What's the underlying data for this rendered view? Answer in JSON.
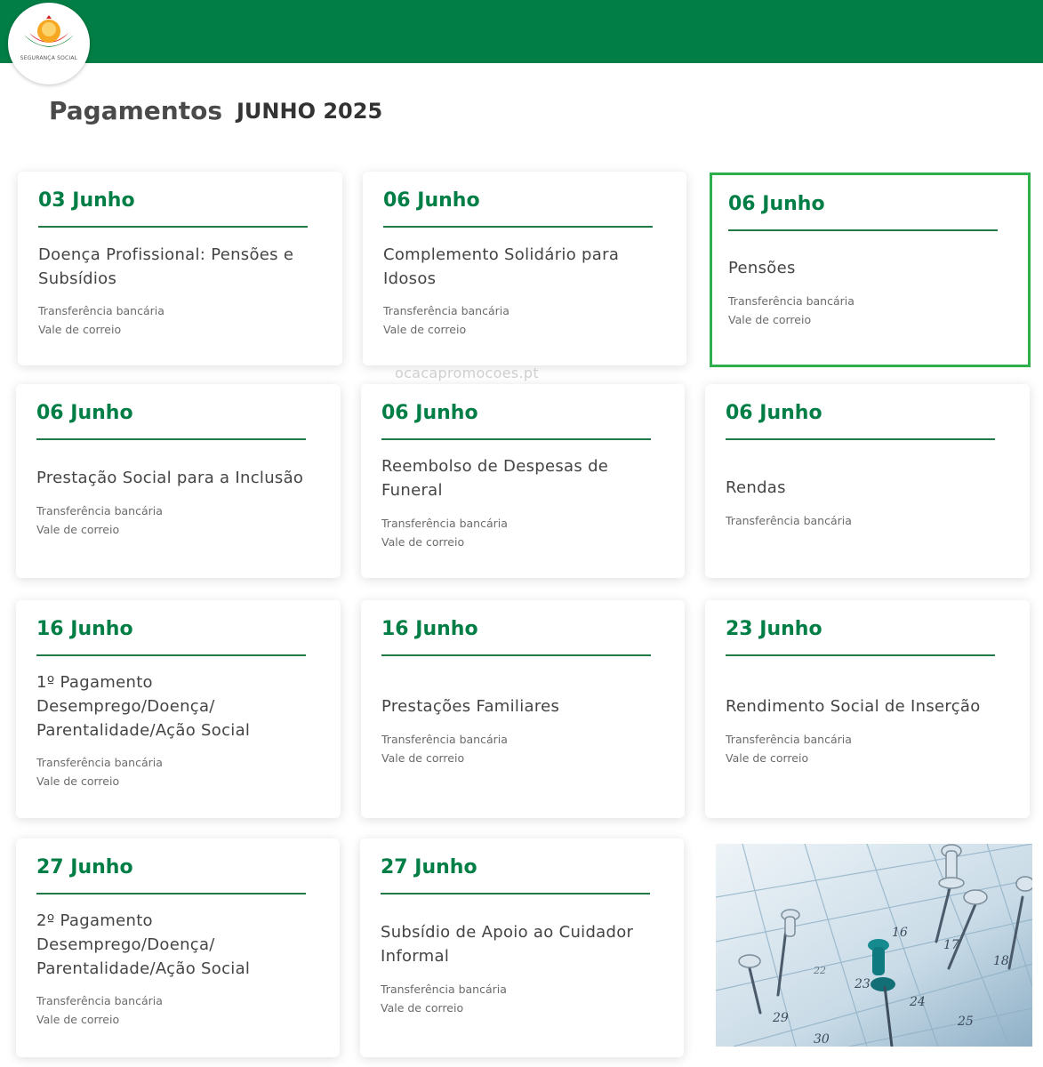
{
  "header": {
    "logo_text": "SEGURANÇA SOCIAL",
    "brand_color": "#007e45"
  },
  "page": {
    "title": "Pagamentos",
    "month": "JUNHO 2025"
  },
  "watermark": "ocacapromocoes.pt",
  "cards": [
    {
      "date": "03 Junho",
      "title_lines": [
        "Doença Profissional: Pensões e",
        "Subsídios"
      ],
      "methods": [
        "Transferência bancária",
        "Vale de correio"
      ]
    },
    {
      "date": "06 Junho",
      "title_lines": [
        "Complemento Solidário para",
        "Idosos"
      ],
      "methods": [
        "Transferência bancária",
        "Vale de correio"
      ]
    },
    {
      "date": "06 Junho",
      "title_lines": [
        "Pensões"
      ],
      "methods": [
        "Transferência bancária",
        "Vale de correio"
      ],
      "highlighted": true
    },
    {
      "date": "06 Junho",
      "title_lines": [
        "Prestação Social para a Inclusão"
      ],
      "methods": [
        "Transferência bancária",
        "Vale de correio"
      ]
    },
    {
      "date": "06 Junho",
      "title_lines": [
        "Reembolso de Despesas de",
        "Funeral"
      ],
      "methods": [
        "Transferência bancária",
        "Vale de correio"
      ]
    },
    {
      "date": "06 Junho",
      "title_lines": [
        "Rendas"
      ],
      "methods": [
        "Transferência bancária"
      ]
    },
    {
      "date": "16 Junho",
      "title_lines": [
        "1º Pagamento",
        "Desemprego/Doença/",
        "Parentalidade/Ação Social"
      ],
      "methods": [
        "Transferência bancária",
        "Vale de correio"
      ]
    },
    {
      "date": "16 Junho",
      "title_lines": [
        "Prestações Familiares"
      ],
      "methods": [
        "Transferência bancária",
        "Vale de correio"
      ]
    },
    {
      "date": "23 Junho",
      "title_lines": [
        "Rendimento Social de Inserção"
      ],
      "methods": [
        "Transferência bancária",
        "Vale de correio"
      ]
    },
    {
      "date": "27 Junho",
      "title_lines": [
        "2º Pagamento",
        "Desemprego/Doença/",
        "Parentalidade/Ação Social"
      ],
      "methods": [
        "Transferência bancária",
        "Vale de correio"
      ]
    },
    {
      "date": "27 Junho",
      "title_lines": [
        "Subsídio de Apoio ao Cuidador",
        "Informal"
      ],
      "methods": [
        "Transferência bancária",
        "Vale de correio"
      ]
    }
  ],
  "photo": {
    "calendar_numbers": [
      "16",
      "17",
      "18",
      "22",
      "23",
      "24",
      "25",
      "29",
      "30"
    ]
  }
}
